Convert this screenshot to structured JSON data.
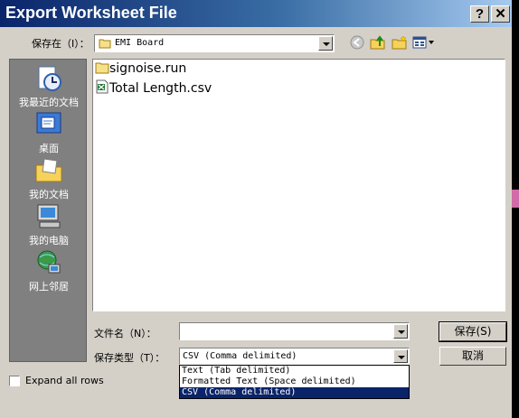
{
  "window": {
    "title": "Export Worksheet File",
    "help_label": "?",
    "close_label": "✕"
  },
  "location": {
    "label": "保存在（I）：",
    "value": "EMI Board"
  },
  "places": [
    {
      "label": "我最近的文档",
      "icon": "recent-docs-icon"
    },
    {
      "label": "桌面",
      "icon": "desktop-icon"
    },
    {
      "label": "我的文档",
      "icon": "my-documents-icon"
    },
    {
      "label": "我的电脑",
      "icon": "my-computer-icon"
    },
    {
      "label": "网上邻居",
      "icon": "network-places-icon"
    }
  ],
  "files": [
    {
      "name": "signoise.run",
      "icon": "folder-icon"
    },
    {
      "name": "Total Length.csv",
      "icon": "excel-file-icon"
    }
  ],
  "filename": {
    "label": "文件名（N）：",
    "value": ""
  },
  "filetype": {
    "label": "保存类型（T）：",
    "value": "CSV (Comma delimited)",
    "options": [
      "Text (Tab delimited)",
      "Formatted Text (Space delimited)",
      "CSV (Comma delimited)"
    ],
    "selected_index": 2
  },
  "buttons": {
    "save": "保存(S)",
    "cancel": "取消"
  },
  "expand_all_rows": {
    "label": "Expand all rows",
    "checked": false
  },
  "colors": {
    "titlebar_start": "#0a246a",
    "titlebar_end": "#a6caf0",
    "dialog_bg": "#d4d0c8",
    "places_bg": "#808080",
    "selection": "#0a246a"
  }
}
